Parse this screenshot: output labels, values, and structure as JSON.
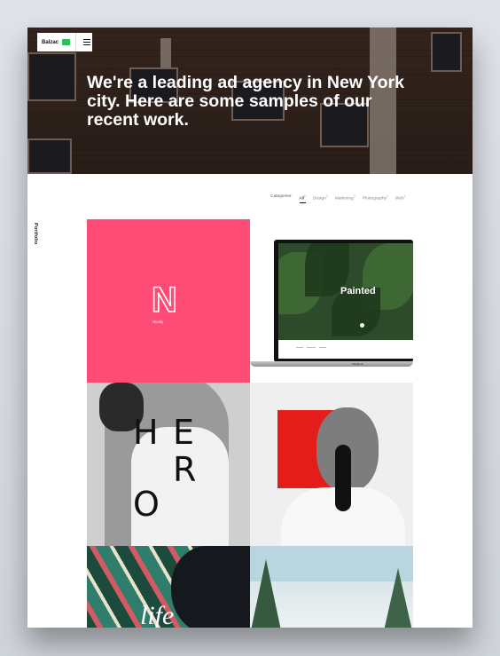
{
  "header": {
    "logo_text": "Balzac",
    "headline": "We're a leading ad agency in New York city. Here are some samples of our recent work."
  },
  "sidebar": {
    "vertical_label": "Portfolio"
  },
  "filters": {
    "label": "Categories:",
    "items": [
      {
        "name": "All",
        "count": "8",
        "active": true
      },
      {
        "name": "Design",
        "count": "2"
      },
      {
        "name": "Marketing",
        "count": "3"
      },
      {
        "name": "Photography",
        "count": "2"
      },
      {
        "name": "Web",
        "count": "1"
      }
    ]
  },
  "portfolio": {
    "tile1": {
      "caption": "Nicely",
      "letter": "N"
    },
    "tile2": {
      "title": "Painted",
      "device_label": "MacBook"
    },
    "tile3": {
      "letters": [
        "H",
        "E",
        "R",
        "O"
      ]
    },
    "tile5": {
      "text": "life"
    }
  },
  "colors": {
    "accent_pink": "#fe4c76",
    "accent_red": "#e31d1a",
    "logo_green": "#2fbf5b"
  }
}
